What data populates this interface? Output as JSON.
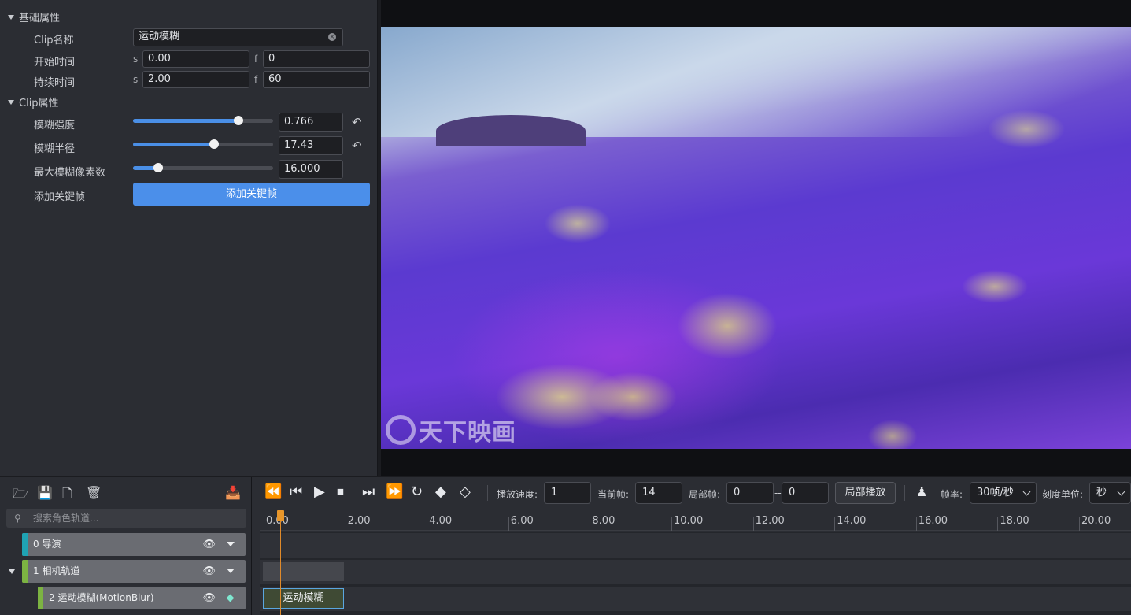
{
  "properties": {
    "basic_section": "基础属性",
    "clip_name_label": "Clip名称",
    "clip_name_value": "运动模糊",
    "start_time_label": "开始时间",
    "start_s_unit": "s",
    "start_s_value": "0.00",
    "start_f_unit": "f",
    "start_f_value": "0",
    "duration_label": "持续时间",
    "duration_s_unit": "s",
    "duration_s_value": "2.00",
    "duration_f_unit": "f",
    "duration_f_value": "60",
    "clip_section": "Clip属性",
    "blur_strength_label": "模糊强度",
    "blur_strength_value": "0.766",
    "blur_strength_fraction": 0.75,
    "blur_radius_label": "模糊半径",
    "blur_radius_value": "17.43",
    "blur_radius_fraction": 0.58,
    "max_pixels_label": "最大模糊像素数",
    "max_pixels_value": "16.000",
    "max_pixels_fraction": 0.18,
    "add_keyframe_label": "添加关键帧",
    "add_keyframe_button": "添加关键帧"
  },
  "preview": {
    "watermark": "天下映画"
  },
  "tracklist": {
    "search_placeholder": "搜索角色轨道...",
    "tracks": [
      {
        "label": "0 导演",
        "color": "#1fa3b3"
      },
      {
        "label": "1 相机轨道",
        "color": "#7cb342"
      },
      {
        "label": "2 运动模糊(MotionBlur)",
        "color": "#7cb342"
      }
    ]
  },
  "playback": {
    "speed_label": "播放速度:",
    "speed_value": "1",
    "current_frame_label": "当前帧:",
    "current_frame_value": "14",
    "local_frame_label": "局部帧:",
    "local_from": "0",
    "local_dash": "--",
    "local_to": "0",
    "local_play_button": "局部播放",
    "fps_label": "帧率:",
    "fps_value": "30帧/秒",
    "scale_label": "刻度单位:",
    "scale_value": "秒"
  },
  "timeline": {
    "ticks": [
      "0.00",
      "2.00",
      "4.00",
      "6.00",
      "8.00",
      "10.00",
      "12.00",
      "14.00",
      "16.00",
      "18.00",
      "20.00"
    ],
    "clip_label": "运动模糊",
    "accent": "#e8962a"
  }
}
